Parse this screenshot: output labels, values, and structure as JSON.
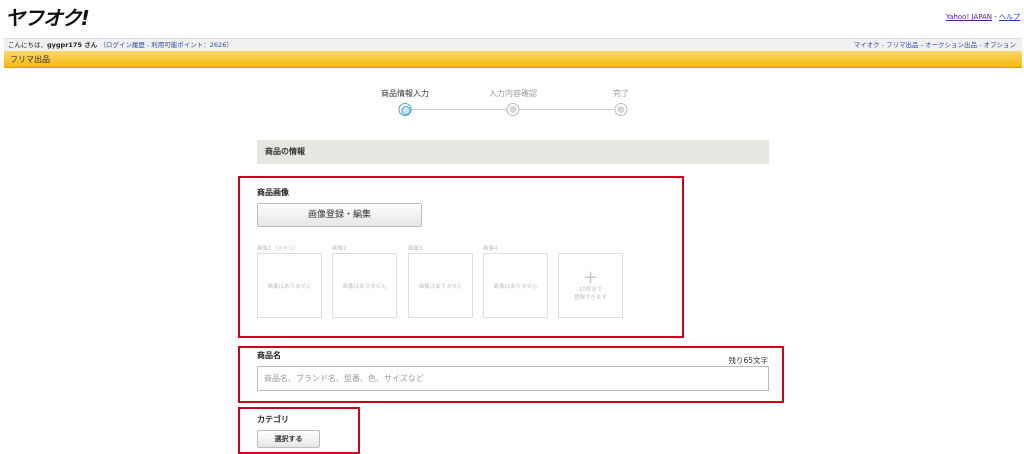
{
  "header": {
    "logo": "ヤフオク!",
    "yahoo_japan": "Yahoo! JAPAN",
    "separator": " - ",
    "help": "ヘルプ"
  },
  "user_bar": {
    "greeting": "こんにちは、",
    "username": "gygpr175 さん",
    "links": "（ログイン履歴 - 利用可能ポイント：2626）",
    "right_links": "マイオク - フリマ出品 - オークション出品 - オプション"
  },
  "page_bar": {
    "title": "フリマ出品"
  },
  "steps": [
    {
      "label": "商品情報入力",
      "active": true
    },
    {
      "label": "入力内容確認",
      "active": false
    },
    {
      "label": "完了",
      "active": false
    }
  ],
  "section": {
    "title": "商品の情報"
  },
  "images": {
    "label": "商品画像",
    "button": "画像登録・編集",
    "slots": [
      {
        "label": "画像1（メイン）",
        "text": "画像はありません"
      },
      {
        "label": "画像2",
        "text": "画像はありません"
      },
      {
        "label": "画像3",
        "text": "画像はありません"
      },
      {
        "label": "画像4",
        "text": "画像はありません"
      }
    ],
    "add_slot": {
      "icon": "plus-icon",
      "line1": "10枚まで",
      "line2": "登録できます"
    }
  },
  "product_name": {
    "label": "商品名",
    "remaining": "残り65文字",
    "placeholder": "商品名、ブランド名、型番、色、サイズなど",
    "value": ""
  },
  "category": {
    "label": "カテゴリ",
    "button": "選択する"
  },
  "colors": {
    "highlight_red": "#d0021b",
    "orange_bar": "#f6b80f",
    "active_step": "#4aa3d8"
  }
}
